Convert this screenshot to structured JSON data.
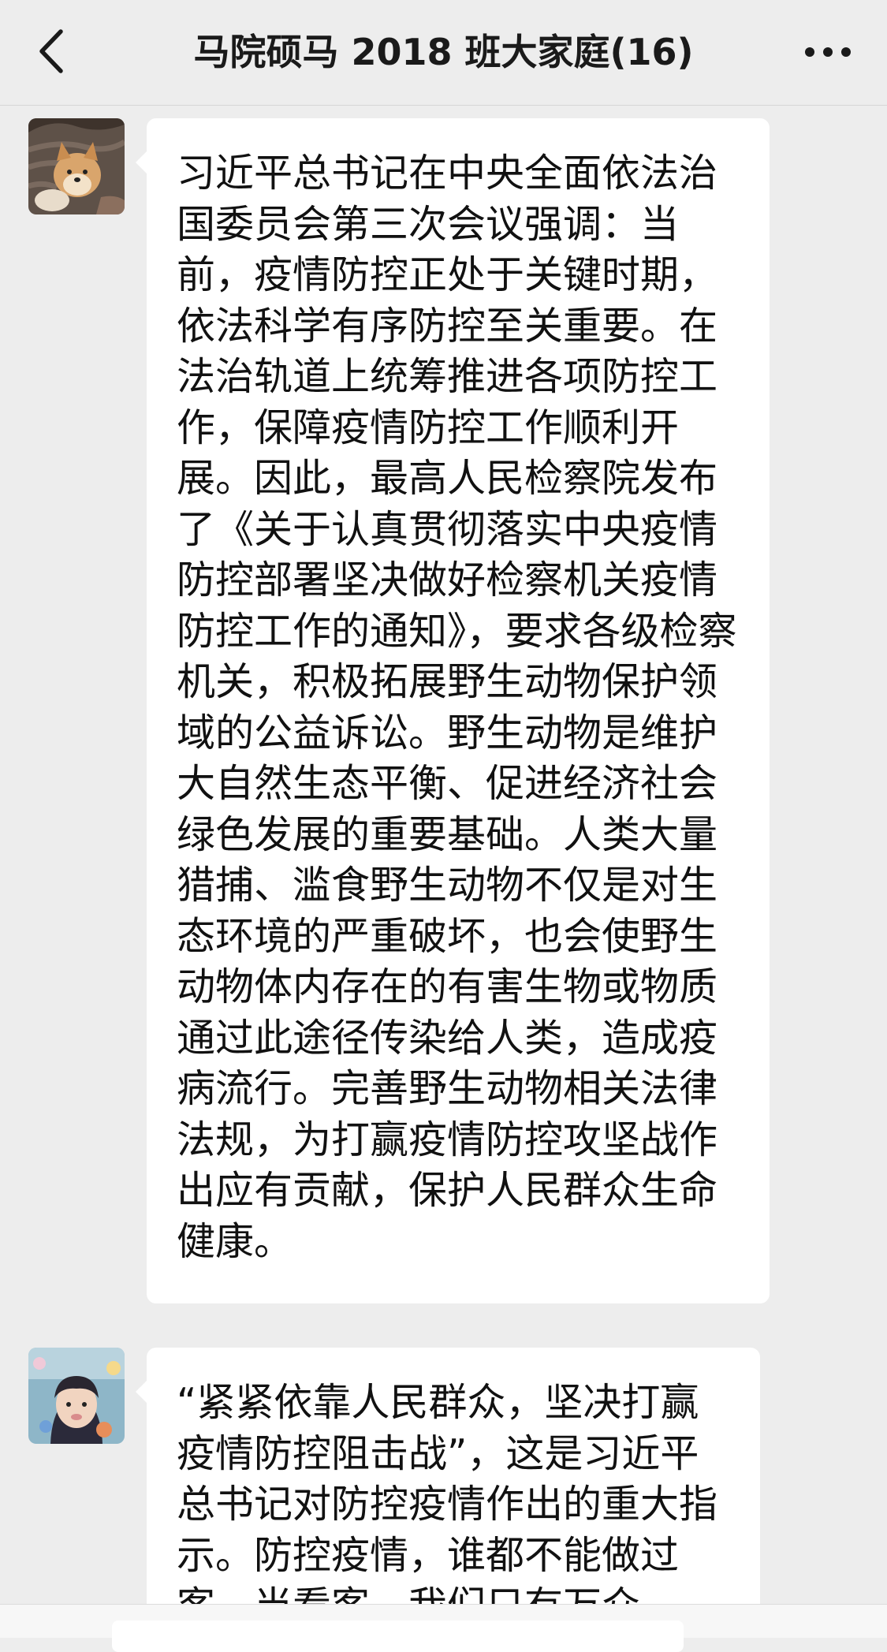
{
  "header": {
    "title": "马院硕马 2018 班大家庭(16)",
    "back_icon": "chevron-left-icon",
    "more_icon": "more-dots-icon"
  },
  "messages": [
    {
      "avatar": "dog-avatar",
      "text": "习近平总书记在中央全面依法治国委员会第三次会议强调：当前，疫情防控正处于关键时期，依法科学有序防控至关重要。在法治轨道上统筹推进各项防控工作，保障疫情防控工作顺利开展。因此，最高人民检察院发布了《关于认真贯彻落实中央疫情防控部署坚决做好检察机关疫情防控工作的通知》，要求各级检察机关，积极拓展野生动物保护领域的公益诉讼。野生动物是维护大自然生态平衡、促进经济社会绿色发展的重要基础。人类大量猎捕、滥食野生动物不仅是对生态环境的严重破坏，也会使野生动物体内存在的有害生物或物质通过此途径传染给人类，造成疫病流行。完善野生动物相关法律法规，为打赢疫情防控攻坚战作出应有贡献，保护人民群众生命健康。"
    },
    {
      "avatar": "child-avatar",
      "text": "“紧紧依靠人民群众，坚决打赢疫情防控阻击战”，这是习近平总书记对防控疫情作出的重大指示。防控疫情，谁都不能做过客、当看客。我们只有万众"
    }
  ],
  "colors": {
    "background": "#ededed",
    "bubble": "#ffffff",
    "text": "#111111"
  }
}
